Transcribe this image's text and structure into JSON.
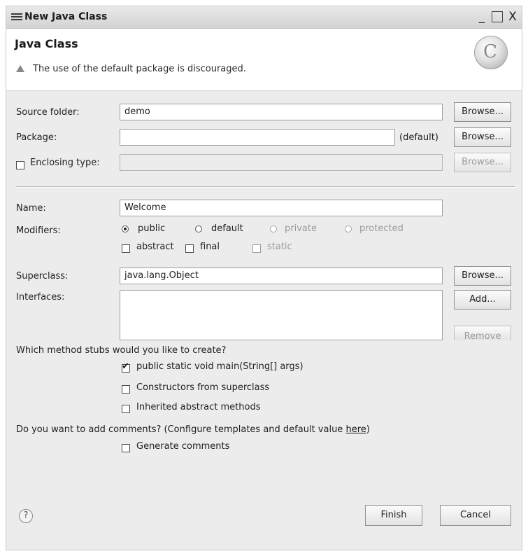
{
  "window": {
    "title": "New Java Class",
    "minimize": "_",
    "close": "X"
  },
  "header": {
    "title": "Java Class",
    "message": "The use of the default package is discouraged.",
    "logo_glyph": "C"
  },
  "source_folder": {
    "label": "Source folder:",
    "value": "demo",
    "browse": "Browse..."
  },
  "package": {
    "label": "Package:",
    "value": "",
    "hint": "(default)",
    "browse": "Browse..."
  },
  "enclosing": {
    "label": "Enclosing type:",
    "checked": false,
    "value": "",
    "browse": "Browse..."
  },
  "name": {
    "label": "Name:",
    "value": "Welcome"
  },
  "modifiers": {
    "label": "Modifiers:",
    "options": [
      {
        "label": "public",
        "selected": true,
        "enabled": true
      },
      {
        "label": "default",
        "selected": false,
        "enabled": true
      },
      {
        "label": "private",
        "selected": false,
        "enabled": false
      },
      {
        "label": "protected",
        "selected": false,
        "enabled": false
      }
    ],
    "abstract": "abstract",
    "final": "final",
    "static": "static"
  },
  "superclass": {
    "label": "Superclass:",
    "value": "java.lang.Object",
    "browse": "Browse..."
  },
  "interfaces": {
    "label": "Interfaces:",
    "add": "Add...",
    "remove": "Remove"
  },
  "stubs": {
    "question": "Which method stubs would you like to create?",
    "main": "public static void main(String[] args)",
    "main_checked": true,
    "constructors": "Constructors from superclass",
    "inherited": "Inherited abstract methods"
  },
  "comments": {
    "question": "Do you want to add comments? (Configure templates and default value",
    "link": "here",
    "close_paren": ")",
    "generate": "Generate comments"
  },
  "footer": {
    "help": "?",
    "finish": "Finish",
    "cancel": "Cancel"
  },
  "icons": [
    "eclipse-window-icon",
    "warning-icon",
    "class-logo-icon",
    "help-icon",
    "checkmark-icon"
  ]
}
